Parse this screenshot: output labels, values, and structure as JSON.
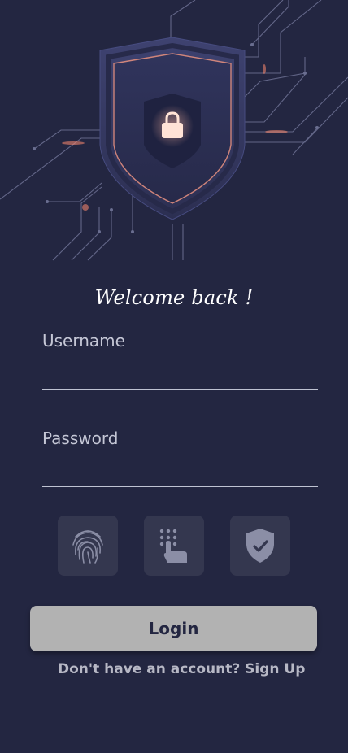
{
  "header": {
    "welcome_text": "Welcome back !"
  },
  "form": {
    "username": {
      "label": "Username",
      "value": ""
    },
    "password": {
      "label": "Password",
      "value": ""
    }
  },
  "auth_options": [
    {
      "name": "fingerprint-icon"
    },
    {
      "name": "touch-keypad-icon"
    },
    {
      "name": "shield-check-icon"
    }
  ],
  "login": {
    "button_label": "Login"
  },
  "signup": {
    "prompt": "Don't have an account? Sign Up"
  },
  "colors": {
    "background": "#232641",
    "button": "#b2b2b2",
    "tile": "#34374f",
    "text_muted": "#c5c7d6"
  }
}
